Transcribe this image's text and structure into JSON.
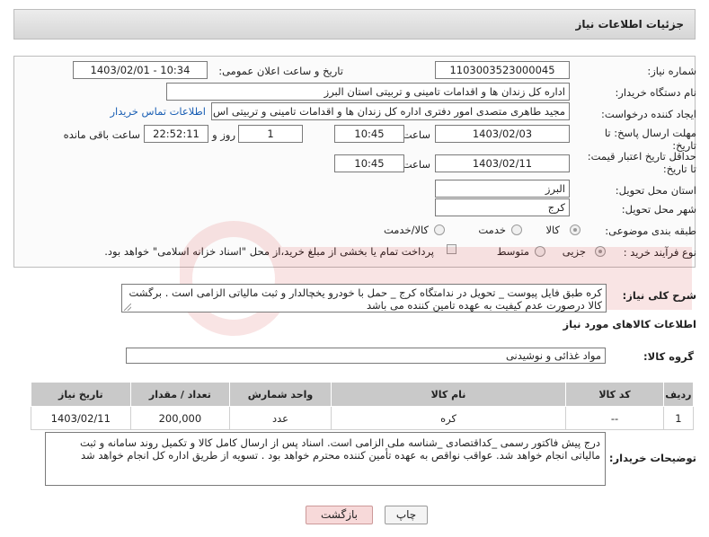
{
  "header": {
    "title": "جزئیات اطلاعات نیاز"
  },
  "form": {
    "need_number_label": "شماره نیاز:",
    "need_number": "1103003523000045",
    "announce_label": "تاریخ و ساعت اعلان عمومی:",
    "announce_value": "1403/02/01 - 10:34",
    "buyer_org_label": "نام دستگاه خریدار:",
    "buyer_org": "اداره کل زندان ها و اقدامات تامینی و تربیتی استان البرز",
    "requester_label": "ایجاد کننده درخواست:",
    "requester": "مجید طاهری متصدی امور دفتری اداره کل زندان ها و اقدامات تامینی و تربیتی اس",
    "contact_link": "اطلاعات تماس خریدار",
    "reply_deadline_label": "مهلت ارسال پاسخ: تا تاریخ:",
    "reply_date": "1403/02/03",
    "time_label": "ساعت",
    "reply_time": "10:45",
    "days_value": "1",
    "days_label": "روز و",
    "remaining_time": "22:52:11",
    "remaining_label": "ساعت باقی مانده",
    "price_validity_label": "حداقل تاریخ اعتبار قیمت: تا تاریخ:",
    "price_validity_date": "1403/02/11",
    "price_validity_time": "10:45",
    "province_label": "استان محل تحویل:",
    "province": "البرز",
    "city_label": "شهر محل تحویل:",
    "city": "کرج",
    "category_label": "طبقه بندی موضوعی:",
    "category_options": [
      "کالا",
      "خدمت",
      "کالا/خدمت"
    ],
    "process_label": "نوع فرآیند خرید :",
    "process_options": [
      "جزیی",
      "متوسط"
    ],
    "payment_note": "پرداخت تمام یا بخشی از مبلغ خرید،از محل \"اسناد خزانه اسلامی\" خواهد بود."
  },
  "description": {
    "label": "شرح کلی نیاز:",
    "text": "کره طبق فایل پیوست _ تحویل در ندامتگاه کرج _ حمل با خودرو یخچالدار و ثبت مالیاتی الزامی است . برگشت کالا درصورت عدم کیفیت به عهده تامین کننده می باشد"
  },
  "goods": {
    "section_title": "اطلاعات کالاهای مورد نیاز",
    "group_label": "گروه کالا:",
    "group_value": "مواد غذائی و نوشیدنی",
    "columns": [
      "ردیف",
      "کد کالا",
      "نام کالا",
      "واحد شمارش",
      "تعداد / مقدار",
      "تاریخ نیاز"
    ],
    "rows": [
      {
        "row": "1",
        "code": "--",
        "name": "کره",
        "unit": "عدد",
        "qty": "200,000",
        "date": "1403/02/11"
      }
    ]
  },
  "buyer_notes": {
    "label": "توضیحات خریدار:",
    "text": "درج پیش فاکتور رسمی _کداقتصادی _شناسه ملی الزامی است. اسناد پس از ارسال کامل کالا و تکمیل روند سامانه و ثبت مالیاتی انجام خواهد شد. عواقب نواقص به عهده تأمین کننده محترم خواهد بود . تسویه از طریق اداره کل انجام خواهد شد"
  },
  "buttons": {
    "print": "چاپ",
    "back": "بازگشت"
  },
  "colors": {
    "link": "#1a5fb4",
    "back_button_bg": "#f7d9d9",
    "header_bg": "#dcdcdc"
  }
}
